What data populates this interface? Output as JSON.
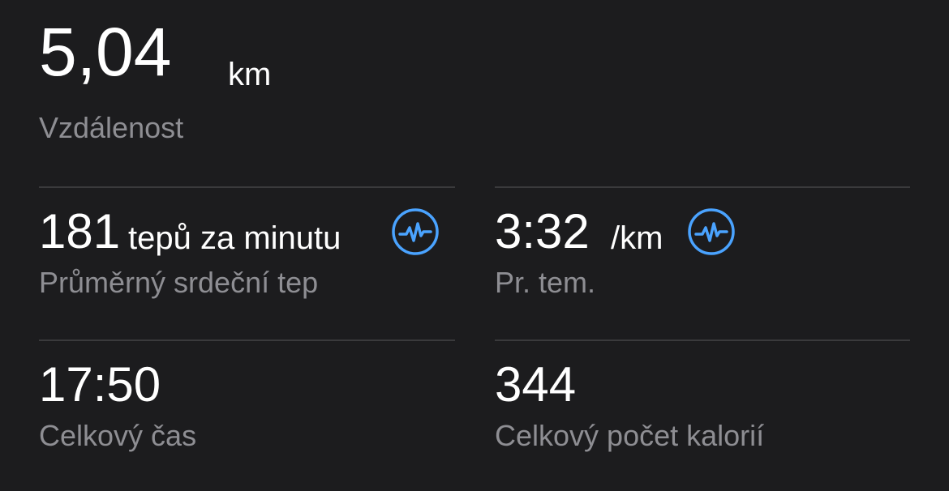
{
  "distance": {
    "value": "5,04",
    "unit": "km",
    "label": "Vzdálenost"
  },
  "heart_rate": {
    "value": "181",
    "unit": "tepů za minutu",
    "label": "Průměrný srdeční tep",
    "icon": "heart-rate-monitor-icon"
  },
  "pace": {
    "value": "3:32",
    "unit": "/km",
    "label": "Pr. tem.",
    "icon": "heart-rate-monitor-icon"
  },
  "total_time": {
    "value": "17:50",
    "label": "Celkový čas"
  },
  "calories": {
    "value": "344",
    "label": "Celkový počet kalorií"
  },
  "colors": {
    "background": "#1c1c1e",
    "primary_text": "#ffffff",
    "secondary_text": "#8e8e93",
    "accent": "#4aa3ff",
    "divider": "#3a3a3c"
  }
}
